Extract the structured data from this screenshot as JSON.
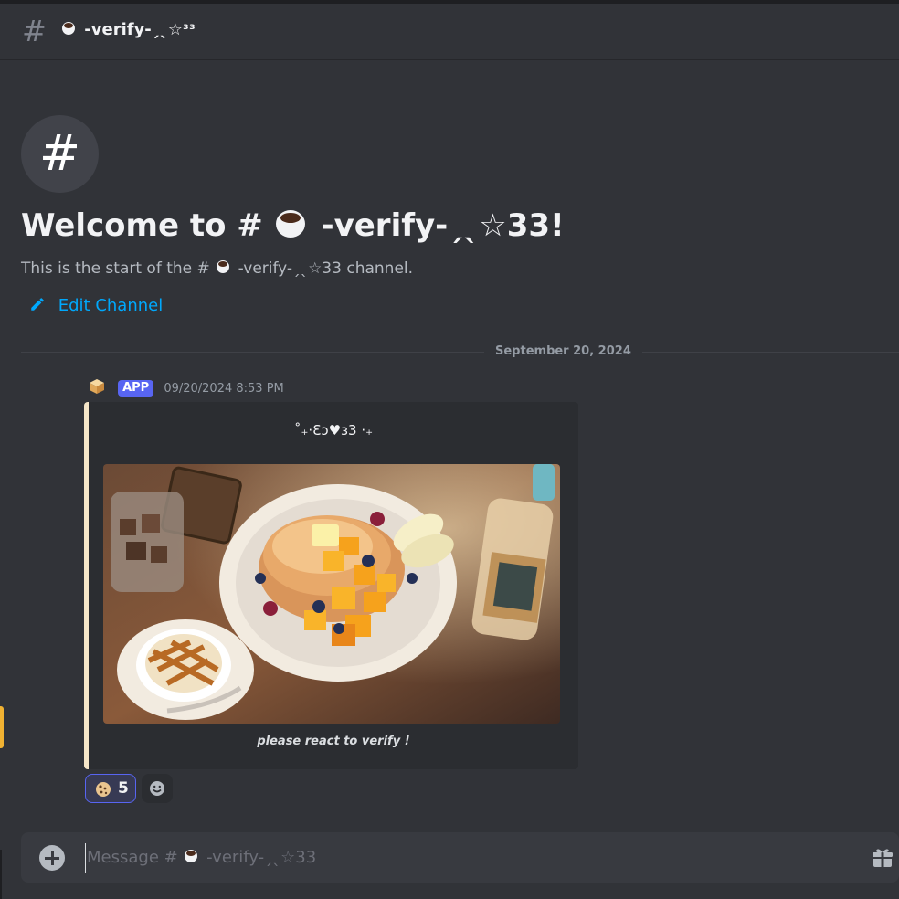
{
  "header": {
    "hash_glyph": "#",
    "channel_name": "-verify-ˏˎ☆ᶟᶟ"
  },
  "welcome": {
    "hash_glyph": "#",
    "title_prefix": "Welcome to #",
    "title_channel": "-verify-ˏˎ☆33!",
    "subtitle_prefix": "This is the start of the #",
    "subtitle_channel": "-verify-ˏˎ☆33",
    "subtitle_suffix": "channel.",
    "edit_label": "Edit Channel"
  },
  "divider": {
    "date": "September 20, 2024"
  },
  "message": {
    "app_tag": "APP",
    "timestamp": "09/20/2024 8:53 PM",
    "embed": {
      "description": "˚₊·Ɛɔ♥ɜ3 ·₊",
      "image_alt": "illustration of pancakes with mango, blueberries, iced coffee, latte and syrup bottle",
      "footer": "please react to verify !"
    },
    "reaction": {
      "emoji": "cookie-icon",
      "count": "5"
    }
  },
  "composer": {
    "placeholder_prefix": "Message #",
    "placeholder_channel": "-verify-ˏˎ☆33"
  },
  "colors": {
    "background": "#313338",
    "accent": "#5865f2",
    "link": "#00a8fc",
    "embed_border": "#f5e6c8"
  }
}
